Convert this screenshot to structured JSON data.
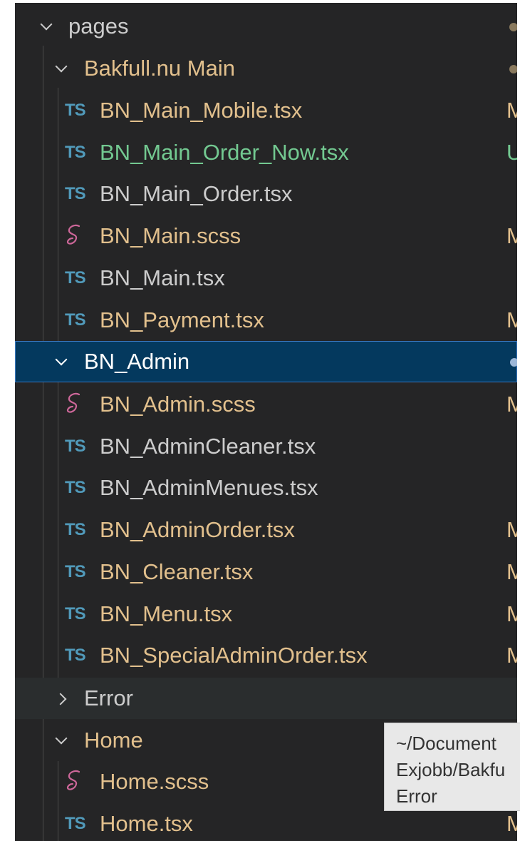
{
  "explorer": {
    "pages_folder": {
      "label": "pages",
      "expanded": true
    },
    "bakfull_folder": {
      "label": "Bakfull.nu Main",
      "expanded": true,
      "color": "#e2c08d"
    },
    "bakfull_files": [
      {
        "name": "BN_Main_Mobile.tsx",
        "icon": "typescript-icon",
        "icon_text": "TS",
        "status": "M",
        "state": "modified"
      },
      {
        "name": "BN_Main_Order_Now.tsx",
        "icon": "typescript-icon",
        "icon_text": "TS",
        "status": "U",
        "state": "untracked"
      },
      {
        "name": "BN_Main_Order.tsx",
        "icon": "typescript-icon",
        "icon_text": "TS",
        "status": "",
        "state": "default"
      },
      {
        "name": "BN_Main.scss",
        "icon": "sass-icon",
        "icon_text": "",
        "status": "M",
        "state": "modified"
      },
      {
        "name": "BN_Main.tsx",
        "icon": "typescript-icon",
        "icon_text": "TS",
        "status": "",
        "state": "default"
      },
      {
        "name": "BN_Payment.tsx",
        "icon": "typescript-icon",
        "icon_text": "TS",
        "status": "M",
        "state": "modified"
      }
    ],
    "admin_folder": {
      "label": "BN_Admin",
      "expanded": true,
      "selected": true
    },
    "admin_files": [
      {
        "name": "BN_Admin.scss",
        "icon": "sass-icon",
        "icon_text": "",
        "status": "M",
        "state": "modified"
      },
      {
        "name": "BN_AdminCleaner.tsx",
        "icon": "typescript-icon",
        "icon_text": "TS",
        "status": "",
        "state": "default"
      },
      {
        "name": "BN_AdminMenues.tsx",
        "icon": "typescript-icon",
        "icon_text": "TS",
        "status": "",
        "state": "default"
      },
      {
        "name": "BN_AdminOrder.tsx",
        "icon": "typescript-icon",
        "icon_text": "TS",
        "status": "M",
        "state": "modified"
      },
      {
        "name": "BN_Cleaner.tsx",
        "icon": "typescript-icon",
        "icon_text": "TS",
        "status": "M",
        "state": "modified"
      },
      {
        "name": "BN_Menu.tsx",
        "icon": "typescript-icon",
        "icon_text": "TS",
        "status": "M",
        "state": "modified"
      },
      {
        "name": "BN_SpecialAdminOrder.tsx",
        "icon": "typescript-icon",
        "icon_text": "TS",
        "status": "M",
        "state": "modified"
      }
    ],
    "error_folder": {
      "label": "Error",
      "expanded": false
    },
    "home_folder": {
      "label": "Home",
      "expanded": true
    },
    "home_files": [
      {
        "name": "Home.scss",
        "icon": "sass-icon",
        "icon_text": "",
        "status": "",
        "state": "modified"
      },
      {
        "name": "Home.tsx",
        "icon": "typescript-icon",
        "icon_text": "TS",
        "status": "M",
        "state": "modified"
      }
    ]
  },
  "tooltip": {
    "line1": "~/Document",
    "line2": "Exjobb/Bakfu",
    "line3": "Error"
  },
  "colors": {
    "background": "#252526",
    "selection": "#04395e",
    "selection_border": "#3a79c1",
    "modified": "#e2c08d",
    "untracked": "#73c991",
    "ts_icon": "#519aba",
    "sass_icon": "#cd6799"
  }
}
